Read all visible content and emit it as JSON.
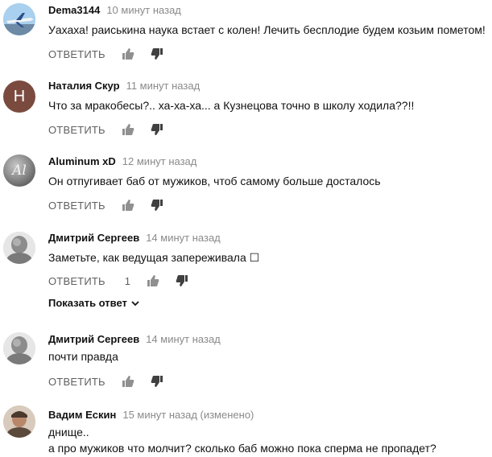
{
  "actions": {
    "reply_label": "ОТВЕТИТЬ"
  },
  "colors": {
    "author": "#111111",
    "time": "#8a8a8a",
    "action": "#606060",
    "avatar_n": "#7b4a3e"
  },
  "comments": [
    {
      "author": "Dema3144",
      "time": "10 минут назад",
      "text": [
        "Уахаха! раиськина наука встает с колен! Лечить бесплодие будем козьим пометом!"
      ],
      "avatar_icon": "airplane-avatar",
      "likes": ""
    },
    {
      "author": "Наталия Скур",
      "time": "11 минут назад",
      "text": [
        "Что за мракобесы?.. ха-ха-ха... а Кузнецова точно в школу ходила??!!"
      ],
      "avatar_icon": "letter-avatar",
      "avatar_letter": "Н",
      "likes": ""
    },
    {
      "author": "Aluminum xD",
      "time": "12 минут назад",
      "text": [
        "Он отпугивает баб от мужиков, чтоб самому больше досталось"
      ],
      "avatar_icon": "al-avatar",
      "avatar_letter": "Al",
      "likes": ""
    },
    {
      "author": "Дмитрий Сергеев",
      "time": "14 минут назад",
      "text": [
        "Заметьте, как ведущая запереживала ☐"
      ],
      "avatar_icon": "photo-avatar",
      "likes": "1"
    },
    {
      "author": "Дмитрий Сергеев",
      "time": "14 минут назад",
      "text": [
        "почти правда"
      ],
      "avatar_icon": "photo-avatar",
      "likes": ""
    },
    {
      "author": "Вадим Ескин",
      "time": "15 минут назад (изменено)",
      "text": [
        "днище..",
        "а про мужиков что молчит? сколько баб можно пока сперма не пропадет?"
      ],
      "avatar_icon": "photo-avatar",
      "likes": ""
    }
  ],
  "show_replies": "Показать ответ"
}
